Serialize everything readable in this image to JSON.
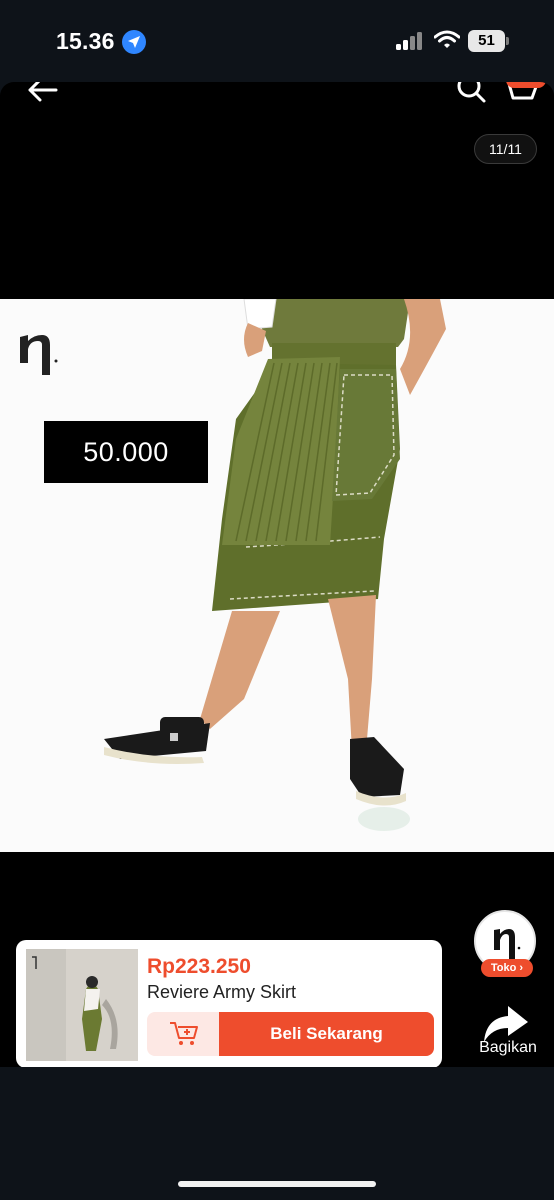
{
  "status_bar": {
    "time": "15.36",
    "battery": "51",
    "icons": [
      "location-arrow-icon",
      "signal-icon",
      "wifi-icon",
      "battery-icon"
    ]
  },
  "header": {
    "icons": [
      "back-arrow-icon",
      "search-icon",
      "cart-icon"
    ],
    "image_counter": "11/11"
  },
  "product_image": {
    "brand_mark": "ŋ.",
    "price_overlay": "50.000"
  },
  "product_card": {
    "price": "Rp223.250",
    "name": "Reviere Army Skirt",
    "buy_now_label": "Beli Sekarang",
    "add_to_cart_icon": "cart-plus-icon"
  },
  "side_actions": {
    "shop_badge": "Toko ›",
    "share_label": "Bagikan"
  },
  "colors": {
    "accent": "#ee4d2d",
    "accent_light": "#fde8e4",
    "background": "#0e1319",
    "skirt_green": "#6b7a32"
  }
}
